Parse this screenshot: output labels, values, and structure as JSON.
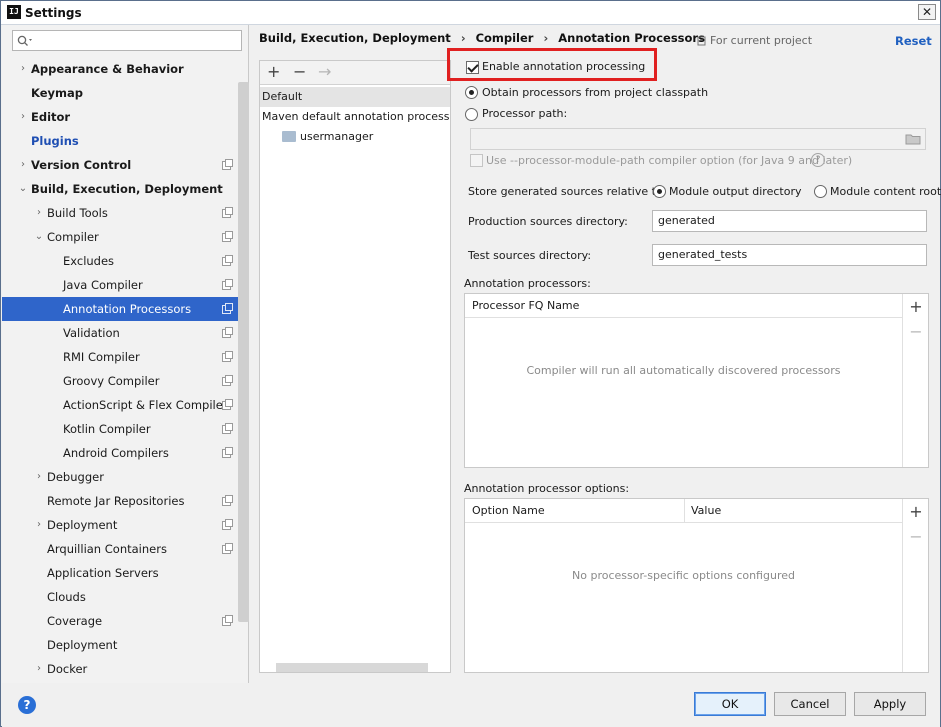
{
  "window": {
    "title": "Settings",
    "logo": "IJ",
    "close": "✕"
  },
  "search": {
    "placeholder": ""
  },
  "tree": [
    {
      "label": "Appearance & Behavior",
      "bold": true,
      "arrow": "right",
      "indent": 0
    },
    {
      "label": "Keymap",
      "bold": true,
      "arrow": "",
      "indent": 0
    },
    {
      "label": "Editor",
      "bold": true,
      "arrow": "right",
      "indent": 0
    },
    {
      "label": "Plugins",
      "bold": true,
      "arrow": "",
      "indent": 0,
      "link": true
    },
    {
      "label": "Version Control",
      "bold": true,
      "arrow": "right",
      "indent": 0,
      "copy": true
    },
    {
      "label": "Build, Execution, Deployment",
      "bold": true,
      "arrow": "down",
      "indent": 0
    },
    {
      "label": "Build Tools",
      "arrow": "right",
      "indent": 1,
      "copy": true
    },
    {
      "label": "Compiler",
      "arrow": "down",
      "indent": 1,
      "copy": true
    },
    {
      "label": "Excludes",
      "arrow": "",
      "indent": 2,
      "copy": true
    },
    {
      "label": "Java Compiler",
      "arrow": "",
      "indent": 2,
      "copy": true
    },
    {
      "label": "Annotation Processors",
      "arrow": "",
      "indent": 2,
      "copy": true,
      "selected": true
    },
    {
      "label": "Validation",
      "arrow": "",
      "indent": 2,
      "copy": true
    },
    {
      "label": "RMI Compiler",
      "arrow": "",
      "indent": 2,
      "copy": true
    },
    {
      "label": "Groovy Compiler",
      "arrow": "",
      "indent": 2,
      "copy": true
    },
    {
      "label": "ActionScript & Flex Compiler",
      "arrow": "",
      "indent": 2,
      "copy": true
    },
    {
      "label": "Kotlin Compiler",
      "arrow": "",
      "indent": 2,
      "copy": true
    },
    {
      "label": "Android Compilers",
      "arrow": "",
      "indent": 2,
      "copy": true
    },
    {
      "label": "Debugger",
      "arrow": "right",
      "indent": 1
    },
    {
      "label": "Remote Jar Repositories",
      "arrow": "",
      "indent": 1,
      "copy": true
    },
    {
      "label": "Deployment",
      "arrow": "right",
      "indent": 1,
      "copy": true
    },
    {
      "label": "Arquillian Containers",
      "arrow": "",
      "indent": 1,
      "copy": true
    },
    {
      "label": "Application Servers",
      "arrow": "",
      "indent": 1
    },
    {
      "label": "Clouds",
      "arrow": "",
      "indent": 1
    },
    {
      "label": "Coverage",
      "arrow": "",
      "indent": 1,
      "copy": true
    },
    {
      "label": "Deployment",
      "arrow": "",
      "indent": 1
    },
    {
      "label": "Docker",
      "arrow": "right",
      "indent": 1
    }
  ],
  "breadcrumb": {
    "parts": [
      "Build, Execution, Deployment",
      "Compiler",
      "Annotation Processors"
    ],
    "sep": "›"
  },
  "for_current_project": "For current project",
  "reset": "Reset",
  "profiles": {
    "toolbar": [
      "+",
      "−",
      "→"
    ],
    "rows": [
      "Default",
      "Maven default annotation processors p",
      "usermanager"
    ]
  },
  "options": {
    "enable": "Enable annotation processing",
    "obtain": "Obtain processors from project classpath",
    "processor_path": "Processor path:",
    "processor_path_value": "",
    "use_module_path": "Use --processor-module-path compiler option (for Java 9 and later)",
    "help_glyph": "?",
    "store_label": "Store generated sources relative to:",
    "module_output": "Module output directory",
    "module_content": "Module content root",
    "prod_label": "Production sources directory:",
    "prod_value": "generated",
    "test_label": "Test sources directory:",
    "test_value": "generated_tests"
  },
  "processors": {
    "title": "Annotation processors:",
    "col": "Processor FQ Name",
    "empty": "Compiler will run all automatically discovered processors",
    "add": "+",
    "remove": "−"
  },
  "proc_options": {
    "title": "Annotation processor options:",
    "col1": "Option Name",
    "col2": "Value",
    "empty": "No processor-specific options configured",
    "add": "+",
    "remove": "−"
  },
  "buttons": {
    "help": "?",
    "ok": "OK",
    "cancel": "Cancel",
    "apply": "Apply"
  },
  "colors": {
    "selection": "#2f65ca",
    "link": "#2060c0",
    "highlight": "#e02020"
  }
}
